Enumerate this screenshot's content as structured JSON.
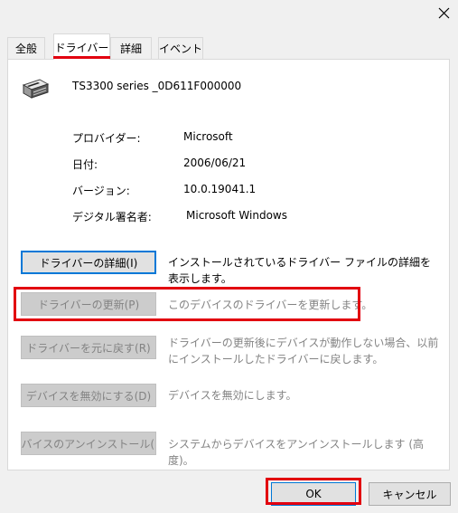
{
  "tabs": [
    {
      "label": "全般",
      "active": false
    },
    {
      "label": "ドライバー",
      "active": true
    },
    {
      "label": "詳細",
      "active": false
    },
    {
      "label": "イベント",
      "active": false
    }
  ],
  "device": {
    "name": "TS3300 series _0D611F000000",
    "icon": "printer-icon"
  },
  "properties": [
    {
      "label": "プロバイダー:",
      "value": "Microsoft"
    },
    {
      "label": "日付:",
      "value": "2006/06/21"
    },
    {
      "label": "バージョン:",
      "value": "10.0.19041.1"
    },
    {
      "label": "デジタル署名者:",
      "value": "Microsoft Windows"
    }
  ],
  "actions": [
    {
      "button": "ドライバーの詳細(I)",
      "description": "インストールされているドライバー ファイルの詳細を表示します。",
      "enabled": true
    },
    {
      "button": "ドライバーの更新(P)",
      "description": "このデバイスのドライバーを更新します。",
      "enabled": false
    },
    {
      "button": "ドライバーを元に戻す(R)",
      "description": "ドライバーの更新後にデバイスが動作しない場合、以前にインストールしたドライバーに戻します。",
      "enabled": false
    },
    {
      "button": "デバイスを無効にする(D)",
      "description": "デバイスを無効にします。",
      "enabled": false
    },
    {
      "button": "デバイスのアンインストール(U)",
      "description": "システムからデバイスをアンインストールします (高度)。",
      "enabled": false
    }
  ],
  "footer": {
    "ok_label": "OK",
    "cancel_label": "キャンセル"
  },
  "colors": {
    "highlight": "#e2000f",
    "focus": "#0078d7",
    "disabled_text": "#838383"
  }
}
